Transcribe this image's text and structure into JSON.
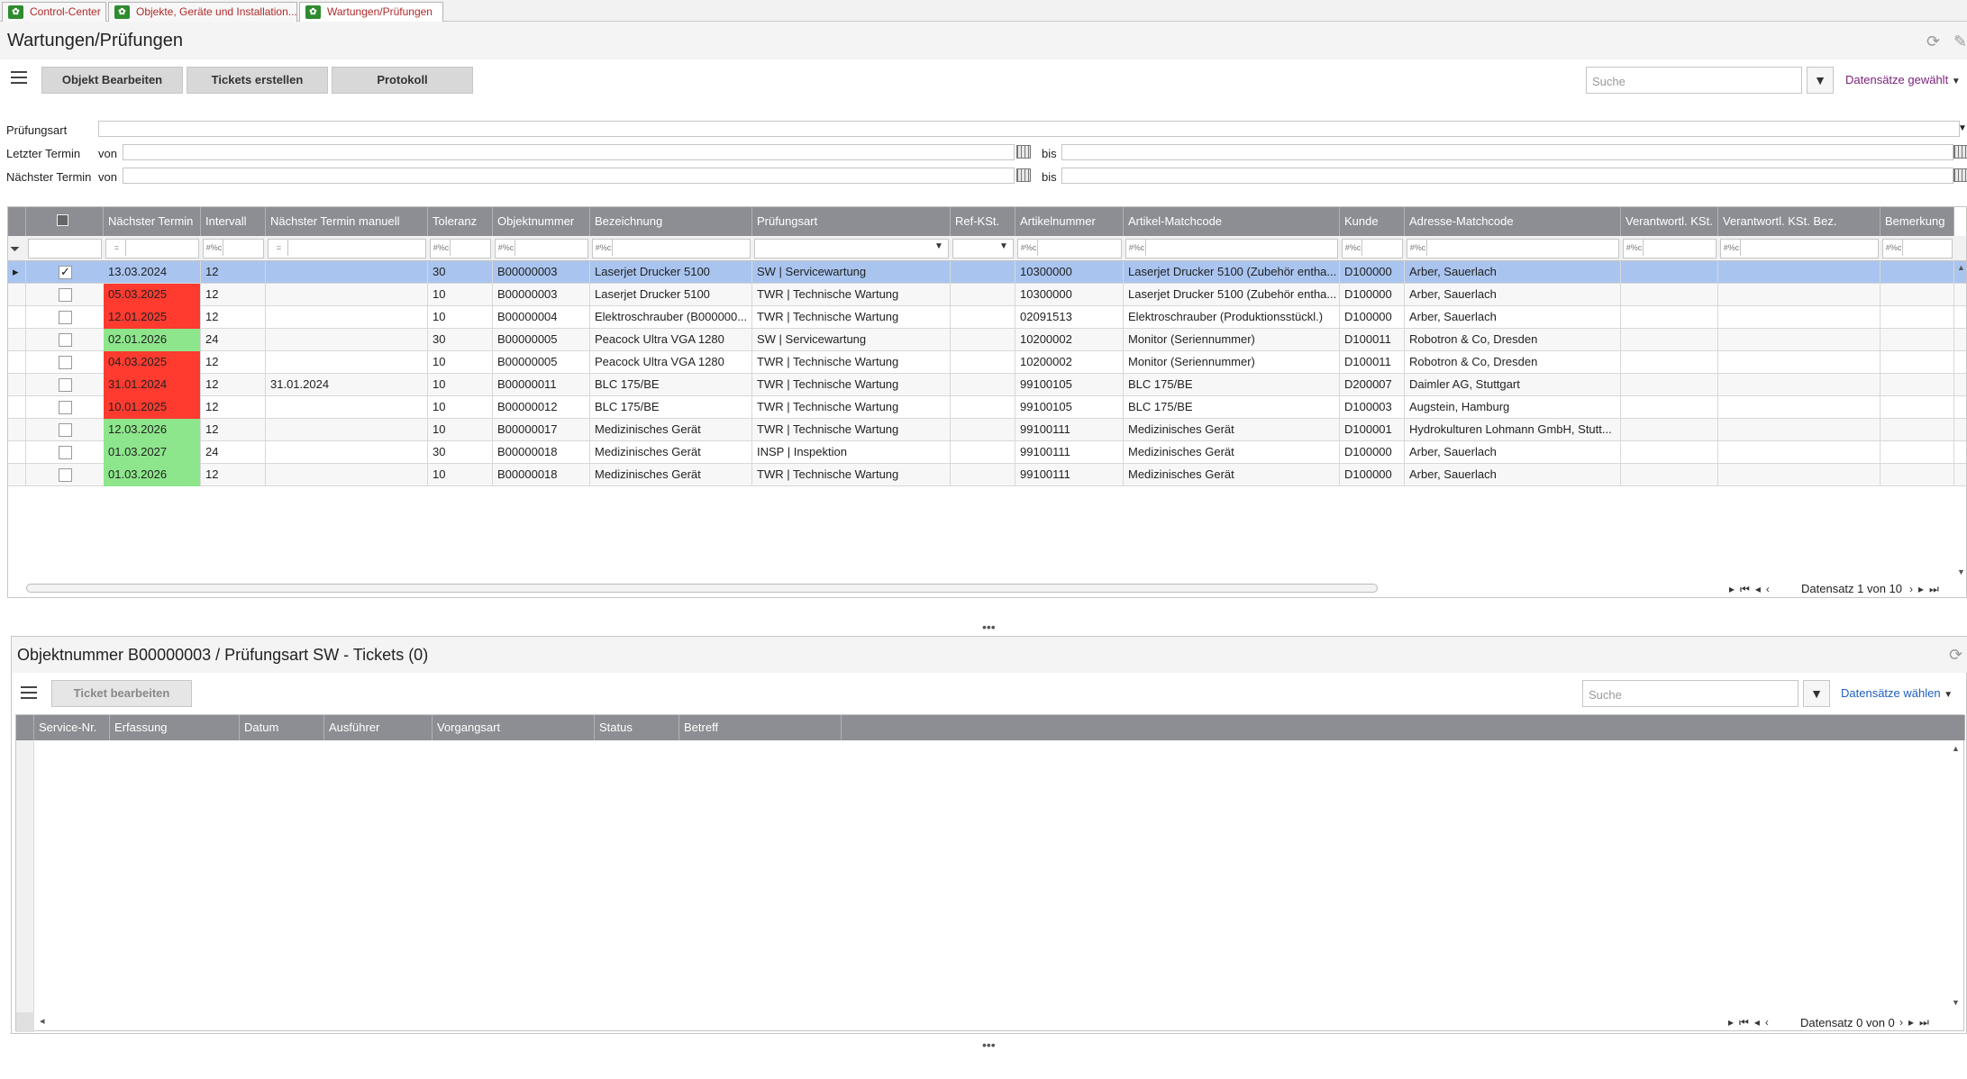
{
  "tabs": [
    {
      "label": "Control-Center"
    },
    {
      "label": "Objekte, Geräte und Installation..."
    },
    {
      "label": "Wartungen/Prüfungen"
    }
  ],
  "page_title": "Wartungen/Prüfungen",
  "toolbar": {
    "buttons": [
      "Objekt Bearbeiten",
      "Tickets erstellen",
      "Protokoll"
    ],
    "search_placeholder": "Suche",
    "records_label": "Datensätze gewählt"
  },
  "filters": {
    "pruefungsart_label": "Prüfungsart",
    "letzter_label": "Letzter Termin",
    "naechster_label": "Nächster Termin",
    "von_label": "von",
    "bis_label": "bis"
  },
  "grid": {
    "columns": [
      "Nächster Termin",
      "Intervall",
      "Nächster Termin manuell",
      "Toleranz",
      "Objektnummer",
      "Bezeichnung",
      "Prüfungsart",
      "Ref-KSt.",
      "Artikelnummer",
      "Artikel-Matchcode",
      "Kunde",
      "Adresse-Matchcode",
      "Verantwortl. KSt.",
      "Verantwortl. KSt. Bez.",
      "Bemerkung"
    ],
    "filter_ops": [
      "=",
      "#%c",
      "=",
      "#%c",
      "#%c",
      "#%c",
      "",
      "",
      "#%c",
      "#%c",
      "#%c",
      "#%c",
      "#%c",
      "#%c",
      "#%c"
    ],
    "rows": [
      {
        "checked": true,
        "selected": true,
        "status": "none",
        "cells": [
          "13.03.2024",
          "12",
          "",
          "30",
          "B00000003",
          "Laserjet Drucker 5100",
          "SW  |  Servicewartung",
          "",
          "10300000",
          "Laserjet Drucker 5100 (Zubehör entha...",
          "D100000",
          "Arber, Sauerlach",
          "",
          "",
          ""
        ]
      },
      {
        "checked": false,
        "selected": false,
        "status": "red",
        "cells": [
          "05.03.2025",
          "12",
          "",
          "10",
          "B00000003",
          "Laserjet Drucker 5100",
          "TWR  |  Technische Wartung",
          "",
          "10300000",
          "Laserjet Drucker 5100 (Zubehör entha...",
          "D100000",
          "Arber, Sauerlach",
          "",
          "",
          ""
        ]
      },
      {
        "checked": false,
        "selected": false,
        "status": "red",
        "cells": [
          "12.01.2025",
          "12",
          "",
          "10",
          "B00000004",
          "Elektroschrauber (B000000...",
          "TWR  |  Technische Wartung",
          "",
          "02091513",
          "Elektroschrauber (Produktionsstückl.)",
          "D100000",
          "Arber, Sauerlach",
          "",
          "",
          ""
        ]
      },
      {
        "checked": false,
        "selected": false,
        "status": "green",
        "cells": [
          "02.01.2026",
          "24",
          "",
          "30",
          "B00000005",
          "Peacock Ultra VGA 1280",
          "SW  |  Servicewartung",
          "",
          "10200002",
          "Monitor (Seriennummer)",
          "D100011",
          "Robotron & Co, Dresden",
          "",
          "",
          ""
        ]
      },
      {
        "checked": false,
        "selected": false,
        "status": "red",
        "cells": [
          "04.03.2025",
          "12",
          "",
          "10",
          "B00000005",
          "Peacock Ultra VGA 1280",
          "TWR  |  Technische Wartung",
          "",
          "10200002",
          "Monitor (Seriennummer)",
          "D100011",
          "Robotron & Co, Dresden",
          "",
          "",
          ""
        ]
      },
      {
        "checked": false,
        "selected": false,
        "status": "red",
        "cells": [
          "31.01.2024",
          "12",
          "31.01.2024",
          "10",
          "B00000011",
          "BLC 175/BE",
          "TWR  |  Technische Wartung",
          "",
          "99100105",
          "BLC 175/BE",
          "D200007",
          "Daimler AG, Stuttgart",
          "",
          "",
          ""
        ]
      },
      {
        "checked": false,
        "selected": false,
        "status": "red",
        "cells": [
          "10.01.2025",
          "12",
          "",
          "10",
          "B00000012",
          "BLC 175/BE",
          "TWR  |  Technische Wartung",
          "",
          "99100105",
          "BLC 175/BE",
          "D100003",
          "Augstein, Hamburg",
          "",
          "",
          ""
        ]
      },
      {
        "checked": false,
        "selected": false,
        "status": "green",
        "cells": [
          "12.03.2026",
          "12",
          "",
          "10",
          "B00000017",
          "Medizinisches Gerät",
          "TWR  |  Technische Wartung",
          "",
          "99100111",
          "Medizinisches Gerät",
          "D100001",
          "Hydrokulturen Lohmann GmbH, Stutt...",
          "",
          "",
          ""
        ]
      },
      {
        "checked": false,
        "selected": false,
        "status": "green",
        "cells": [
          "01.03.2027",
          "24",
          "",
          "30",
          "B00000018",
          "Medizinisches Gerät",
          "INSP  |  Inspektion",
          "",
          "99100111",
          "Medizinisches Gerät",
          "D100000",
          "Arber, Sauerlach",
          "",
          "",
          ""
        ]
      },
      {
        "checked": false,
        "selected": false,
        "status": "green",
        "cells": [
          "01.03.2026",
          "12",
          "",
          "10",
          "B00000018",
          "Medizinisches Gerät",
          "TWR  |  Technische Wartung",
          "",
          "99100111",
          "Medizinisches Gerät",
          "D100000",
          "Arber, Sauerlach",
          "",
          "",
          ""
        ]
      }
    ],
    "record_info": "Datensatz 1 von 10"
  },
  "colors": {
    "red": "#ff3b30",
    "green": "#8de68b",
    "selected": "#a9c4ef",
    "header": "#8c8e93",
    "purple": "#7a1f7a",
    "blue": "#1f5fbf"
  },
  "detail": {
    "title": "Objektnummer  B00000003 / Prüfungsart SW - Tickets (0)",
    "button": "Ticket bearbeiten",
    "search_placeholder": "Suche",
    "records_label": "Datensätze wählen",
    "columns": [
      "Service-Nr.",
      "Erfassung",
      "Datum",
      "Ausführer",
      "Vorgangsart",
      "Status",
      "Betreff"
    ],
    "record_info": "Datensatz 0 von 0"
  }
}
